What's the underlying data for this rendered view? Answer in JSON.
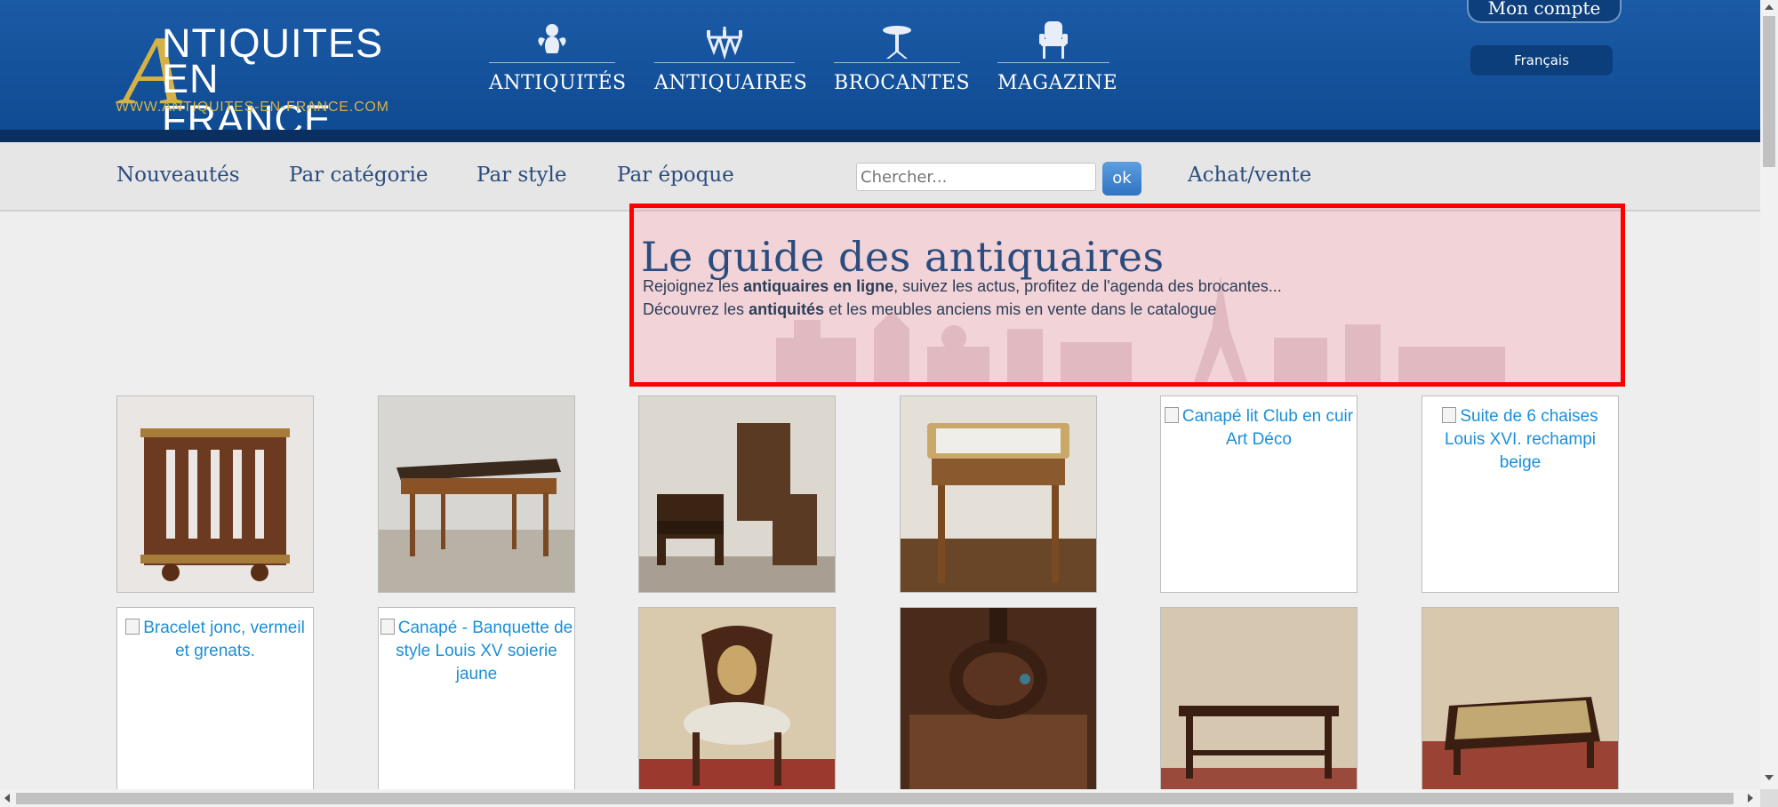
{
  "header": {
    "logo": {
      "line1": "NTIQUITES",
      "line2": "EN FRANCE",
      "letter": "A",
      "url": "WWW.ANTIQUITES-EN-FRANCE.COM"
    },
    "nav": [
      {
        "label": "ANTIQUITÉS",
        "icon": "cherub-icon"
      },
      {
        "label": "ANTIQUAIRES",
        "icon": "chandelier-icon"
      },
      {
        "label": "BROCANTES",
        "icon": "gueridon-table-icon"
      },
      {
        "label": "MAGAZINE",
        "icon": "armchair-icon"
      }
    ],
    "account_label": "Mon compte",
    "language_label": "Français"
  },
  "subnav": {
    "links": [
      "Nouveautés",
      "Par catégorie",
      "Par style",
      "Par époque"
    ],
    "search_placeholder": "Chercher...",
    "search_button": "ok",
    "achat_vente": "Achat/vente"
  },
  "hero": {
    "title": "Le guide des antiquaires",
    "line1_pre": "Rejoignez les ",
    "line1_bold": "antiquaires en ligne",
    "line1_post": ", suivez les actus, profitez de l'agenda des brocantes...",
    "line2_pre": "Découvrez les ",
    "line2_bold": "antiquités",
    "line2_post": " et les meubles anciens mis en vente dans le catalogue"
  },
  "products": [
    {
      "kind": "image",
      "subject": "revolving-bookcase"
    },
    {
      "kind": "image",
      "subject": "leather-top-desk"
    },
    {
      "kind": "image",
      "subject": "carved-panels-and-chair"
    },
    {
      "kind": "image",
      "subject": "marble-top-side-table"
    },
    {
      "kind": "broken",
      "alt": "Canapé lit Club en cuir Art Déco"
    },
    {
      "kind": "broken",
      "alt": "Suite de 6 chaises Louis XVI. rechampi beige"
    },
    {
      "kind": "broken",
      "alt": "Bracelet jonc, vermeil et grenats."
    },
    {
      "kind": "broken",
      "alt": "Canapé - Banquette de style Louis XV soierie jaune"
    },
    {
      "kind": "image",
      "subject": "cane-back-chair"
    },
    {
      "kind": "image",
      "subject": "carved-vase-pedestal"
    },
    {
      "kind": "image",
      "subject": "console-table"
    },
    {
      "kind": "image",
      "subject": "lacquered-coffee-table"
    }
  ],
  "colors": {
    "header_blue": "#0e4a91",
    "gold": "#d5b246",
    "link_blue": "#2b4c7e",
    "alt_link": "#1a8fd8",
    "highlight_border": "#ff0000"
  }
}
